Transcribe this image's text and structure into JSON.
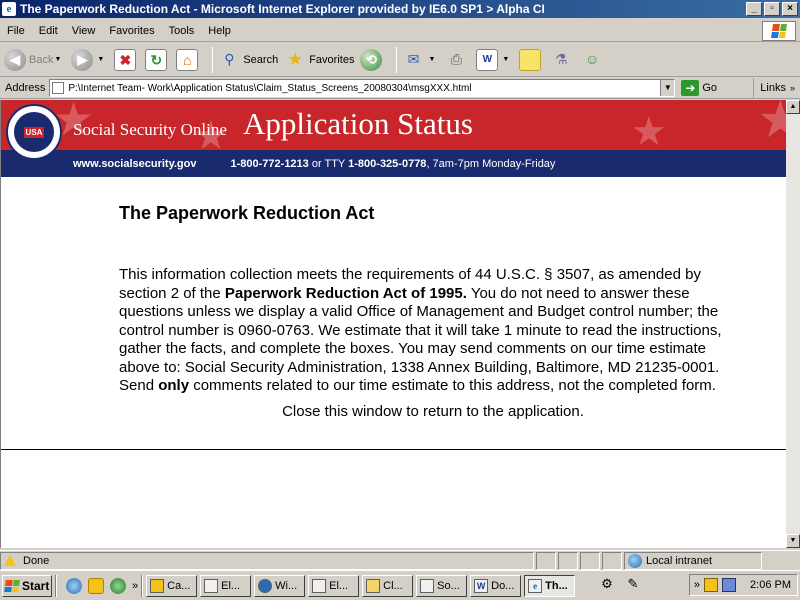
{
  "window": {
    "title": "The Paperwork Reduction Act - Microsoft Internet Explorer provided by IE6.0 SP1 > Alpha CI",
    "buttons": {
      "minimize": "_",
      "maximize": "▫",
      "close": "×"
    }
  },
  "menu": [
    "File",
    "Edit",
    "View",
    "Favorites",
    "Tools",
    "Help"
  ],
  "toolbar": {
    "back_label": "Back",
    "search_label": "Search",
    "favorites_label": "Favorites"
  },
  "address": {
    "label": "Address",
    "value": "P:\\Internet Team- Work\\Application Status\\Claim_Status_Screens_20080304\\msgXXX.html",
    "go_label": "Go",
    "links_label": "Links"
  },
  "banner": {
    "seal_text": "USA",
    "brand": "Social Security Online",
    "title": "Application Status",
    "website": "www.socialsecurity.gov",
    "phone_main": "1-800-772-1213",
    "phone_or": "or TTY",
    "phone_tty": "1-800-325-0778",
    "hours": ", 7am-7pm Monday-Friday",
    "colors": {
      "red": "#c8262b",
      "navy": "#1a2a6e"
    }
  },
  "content": {
    "heading": "The Paperwork Reduction Act",
    "para_part1": "This information collection meets the requirements of 44 U.S.C. § 3507, as amended by section 2 of the ",
    "para_bold1": "Paperwork Reduction Act of 1995.",
    "para_part2": " You do not need to answer these questions unless we display a valid Office of Management and Budget control number; the control number is 0960-0763. We estimate that it will take 1 minute to read the instructions, gather the facts, and complete the boxes. You may send comments on our time estimate above to: Social Security Administration, 1338 Annex Building, Baltimore, MD 21235-0001. Send ",
    "para_bold2": "only",
    "para_part3": " comments related to our time estimate to this address, not the completed form.",
    "close_note": "Close this window to return to the application."
  },
  "status": {
    "text": "Done",
    "zone": "Local intranet"
  },
  "taskbar": {
    "start_label": "Start",
    "tasks": [
      {
        "label": "Ca...",
        "icon": "clock-icon"
      },
      {
        "label": "El...",
        "icon": "window-icon"
      },
      {
        "label": "Wi...",
        "icon": "media-icon"
      },
      {
        "label": "El...",
        "icon": "window-icon"
      },
      {
        "label": "Cl...",
        "icon": "folder-icon"
      },
      {
        "label": "So...",
        "icon": "window-icon"
      },
      {
        "label": "Do...",
        "icon": "word-icon"
      },
      {
        "label": "Th...",
        "icon": "ie-icon",
        "active": true
      }
    ],
    "chevron": "»",
    "clock": "2:06 PM"
  }
}
